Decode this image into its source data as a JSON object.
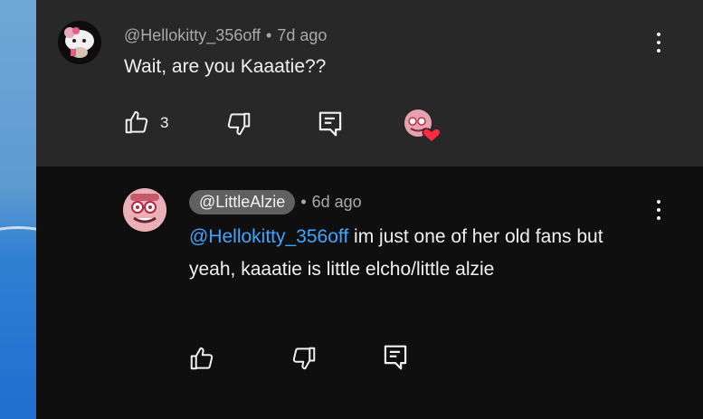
{
  "comment": {
    "author": "@Hellokitty_356off",
    "time": "7d ago",
    "separator": "•",
    "text": "Wait, are you Kaaatie??",
    "like_count": "3",
    "heart_icon_color": "#ff2a3d",
    "icons": [
      "like-icon",
      "dislike-icon",
      "reply-icon",
      "creator-heart-icon",
      "more-icon"
    ]
  },
  "reply": {
    "author": "@LittleAlzie",
    "time": "6d ago",
    "separator": "•",
    "mention": "@Hellokitty_356off",
    "text": " im just one of her old fans but yeah, kaaatie is little elcho/little alzie",
    "icons": [
      "like-icon",
      "dislike-icon",
      "reply-icon",
      "more-icon"
    ]
  },
  "colors": {
    "top_panel_bg": "#282828",
    "bottom_panel_bg": "#0f0f0f",
    "mention": "#3ea6ff",
    "meta_text": "#aaaaaa",
    "chip_bg": "#606060"
  }
}
